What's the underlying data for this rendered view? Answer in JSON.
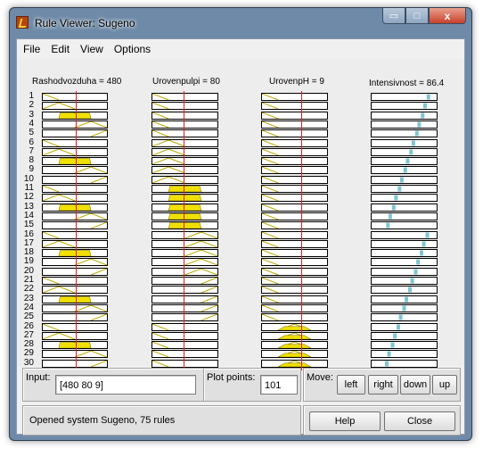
{
  "window": {
    "title": "Rule Viewer: Sugeno",
    "controls": {
      "minimize": "▭",
      "maximize": "□",
      "close": "x"
    }
  },
  "menu": [
    "File",
    "Edit",
    "View",
    "Options"
  ],
  "columns": [
    {
      "label": "Rashodvozduha = 480",
      "line_fraction": 0.52
    },
    {
      "label": "Urovenpulpi = 80",
      "line_fraction": 0.48
    },
    {
      "label": "UrovenpH = 9",
      "line_fraction": 0.6
    },
    {
      "label": "Intensivnost = 86.4"
    }
  ],
  "rule_numbers": [
    "1",
    "2",
    "3",
    "4",
    "5",
    "6",
    "7",
    "8",
    "9",
    "10",
    "11",
    "12",
    "13",
    "14",
    "15",
    "16",
    "17",
    "18",
    "19",
    "20",
    "21",
    "22",
    "23",
    "24",
    "25",
    "26",
    "27",
    "28",
    "29",
    "30"
  ],
  "colors": {
    "fill": "#f0e000",
    "membership_line": "#b8a800",
    "input_line": "#e41b1b",
    "output_dot": "#7fc5cf"
  },
  "mf_assignments": {
    "col1": [
      0,
      1,
      2,
      3,
      4,
      0,
      1,
      2,
      3,
      4,
      0,
      1,
      2,
      3,
      4,
      0,
      1,
      2,
      3,
      4,
      0,
      1,
      2,
      3,
      4,
      0,
      1,
      2,
      3,
      4
    ],
    "col2": [
      0,
      0,
      0,
      0,
      0,
      1,
      1,
      1,
      1,
      1,
      2,
      2,
      2,
      2,
      2,
      3,
      3,
      3,
      3,
      3,
      4,
      4,
      4,
      4,
      4,
      0,
      0,
      0,
      0,
      0
    ],
    "col3": [
      0,
      0,
      0,
      0,
      0,
      0,
      0,
      0,
      0,
      0,
      0,
      0,
      0,
      0,
      0,
      0,
      0,
      0,
      0,
      0,
      0,
      0,
      0,
      0,
      0,
      2,
      2,
      2,
      2,
      2
    ]
  },
  "outputs": [
    0.92,
    0.86,
    0.82,
    0.76,
    0.72,
    0.66,
    0.62,
    0.56,
    0.52,
    0.46,
    0.42,
    0.36,
    0.32,
    0.26,
    0.22,
    0.9,
    0.84,
    0.8,
    0.74,
    0.7,
    0.64,
    0.6,
    0.54,
    0.5,
    0.44,
    0.4,
    0.34,
    0.3,
    0.24,
    0.2
  ],
  "input": {
    "label": "Input:",
    "value": "[480 80 9]"
  },
  "plot_points": {
    "label": "Plot points:",
    "value": "101"
  },
  "move": {
    "label": "Move:",
    "left": "left",
    "right": "right",
    "down": "down",
    "up": "up"
  },
  "status": "Opened system Sugeno, 75 rules",
  "buttons": {
    "help": "Help",
    "close": "Close"
  }
}
